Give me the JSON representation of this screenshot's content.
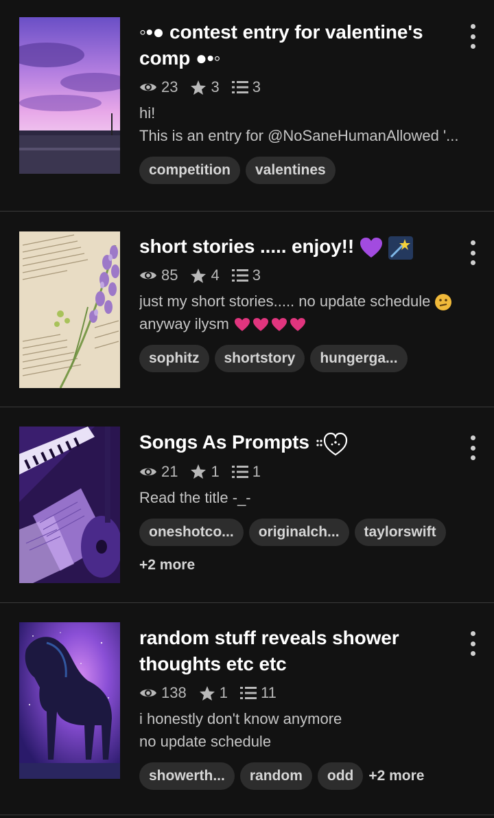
{
  "stories": [
    {
      "title": "◦•● contest entry for valentine's comp ●•◦",
      "views": "23",
      "votes": "3",
      "parts": "3",
      "description": [
        "hi!",
        "This is an entry for @NoSaneHumanAllowed '..."
      ],
      "tags": [
        "competition",
        "valentines"
      ],
      "more": ""
    },
    {
      "title": "short stories ..... enjoy!!",
      "views": "85",
      "votes": "4",
      "parts": "3",
      "description": [
        "just my short stories..... no update schedule",
        "anyway ilysm"
      ],
      "tags": [
        "sophitz",
        "shortstory",
        "hungerga..."
      ],
      "more": ""
    },
    {
      "title": "Songs As Prompts",
      "views": "21",
      "votes": "1",
      "parts": "1",
      "description": [
        "Read the title -_-"
      ],
      "tags": [
        "oneshotco...",
        "originalch...",
        "taylorswift"
      ],
      "more": "+2 more"
    },
    {
      "title": "random stuff reveals shower thoughts etc etc",
      "views": "138",
      "votes": "1",
      "parts": "11",
      "description": [
        "i honestly don't know anymore",
        "no update schedule"
      ],
      "tags": [
        "showerth...",
        "random",
        "odd"
      ],
      "more": "+2 more"
    }
  ],
  "icons": {
    "views": "eye-icon",
    "votes": "star-icon",
    "parts": "list-icon",
    "menu": "more-vertical-icon"
  },
  "colors": {
    "background": "#121212",
    "tag_background": "#2d2d2d",
    "meta_text": "#b9b9b9"
  }
}
